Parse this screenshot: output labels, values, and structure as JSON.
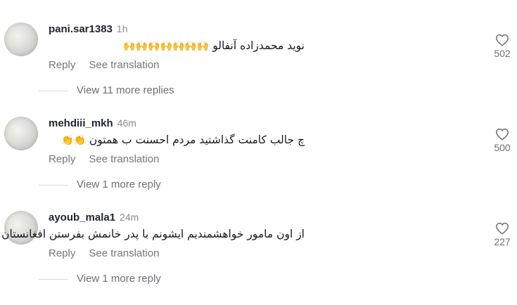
{
  "comments": [
    {
      "username": "pani.sar1383",
      "time": "1h",
      "text": "نوید محمدزاده آنفالو",
      "emojis": "🙌🙌🙌🙌🙌🙌🙌",
      "reply_label": "Reply",
      "translate_label": "See translation",
      "likes": "502",
      "more_replies": "View 11 more replies"
    },
    {
      "username": "mehdiii_mkh",
      "time": "46m",
      "text": "چ جالب کامنت گذاشتید مردم احسنت ب همتون",
      "emojis": "👏👏",
      "reply_label": "Reply",
      "translate_label": "See translation",
      "likes": "500",
      "more_replies": "View 1 more reply"
    },
    {
      "username": "ayoub_mala1",
      "time": "24m",
      "text": "از اون مامور خواهشمندیم ایشونم با پدر خانمش بفرستن افغانستان",
      "emojis": "",
      "reply_label": "Reply",
      "translate_label": "See translation",
      "likes": "227",
      "more_replies": "View 1 more reply"
    }
  ],
  "colors": {
    "text": "#161823",
    "muted": "#75767c",
    "divider": "#d9d9db"
  },
  "icons": {
    "like": "heart-outline-icon",
    "avatar": "avatar-blurred"
  }
}
